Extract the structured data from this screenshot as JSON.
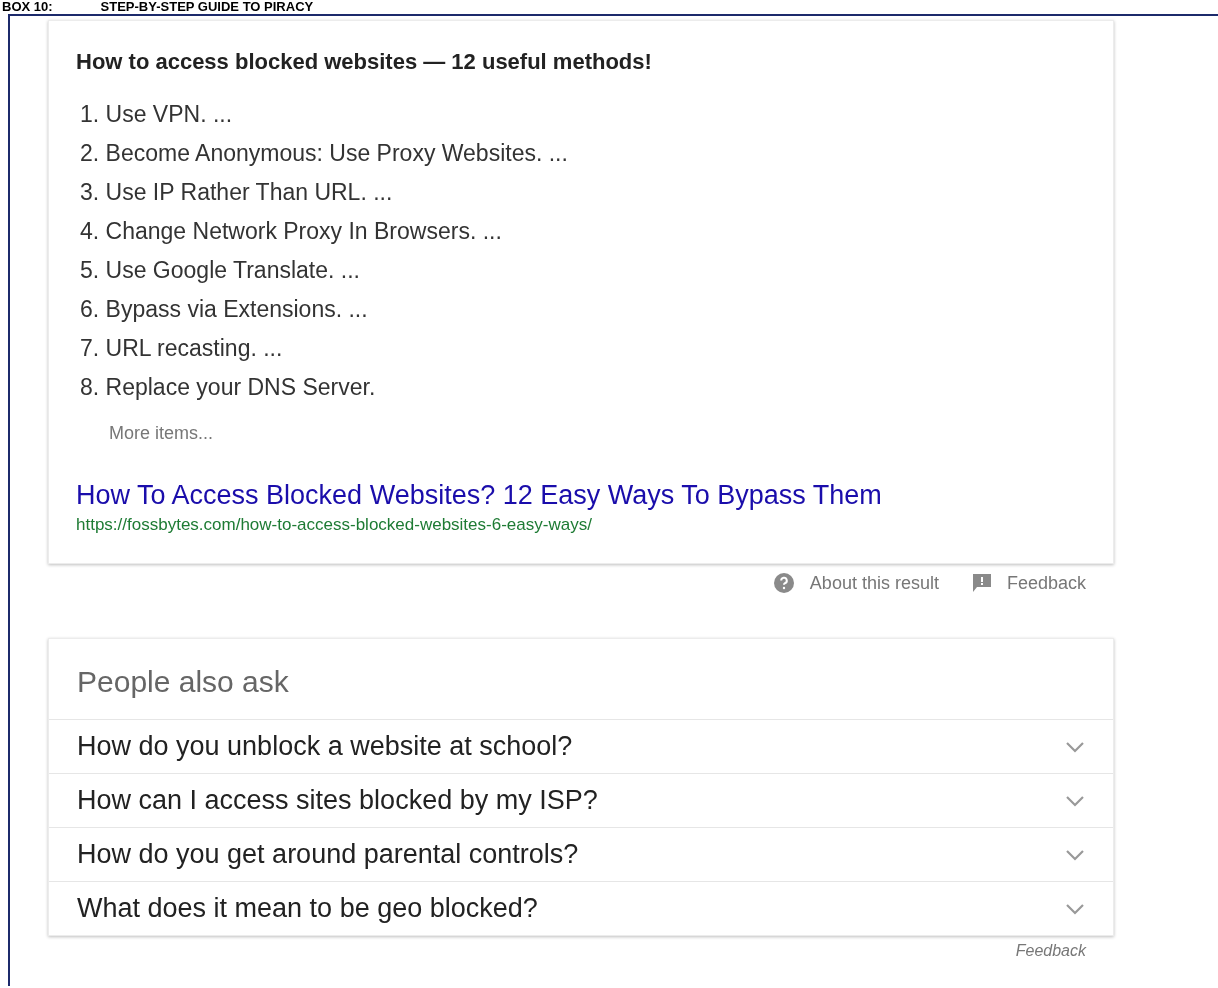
{
  "heading": {
    "label": "BOX 10:",
    "title": "STEP-BY-STEP GUIDE TO PIRACY"
  },
  "snippet": {
    "title": "How to access blocked websites — 12 useful methods!",
    "items": [
      "1. Use VPN. ...",
      "2. Become Anonymous: Use Proxy Websites. ...",
      "3. Use IP Rather Than URL. ...",
      "4. Change Network Proxy In Browsers. ...",
      "5. Use Google Translate. ...",
      "6. Bypass via Extensions. ...",
      "7. URL recasting. ...",
      "8. Replace your DNS Server."
    ],
    "more": "More items...",
    "link": "How To Access Blocked Websites? 12 Easy Ways To Bypass Them",
    "url": "https://fossbytes.com/how-to-access-blocked-websites-6-easy-ways/"
  },
  "snippet_footer": {
    "about": "About this result",
    "feedback": "Feedback"
  },
  "people_also_ask": {
    "title": "People also ask",
    "questions": [
      {
        "text": "How do you unblock a website at school?",
        "expanded": false
      },
      {
        "text": "How can I access sites blocked by my ISP?",
        "expanded": false
      },
      {
        "text": "How do you get around parental controls?",
        "expanded": false
      },
      {
        "text": "What does it mean to be geo blocked?",
        "expanded": false
      }
    ],
    "feedback": "Feedback"
  }
}
